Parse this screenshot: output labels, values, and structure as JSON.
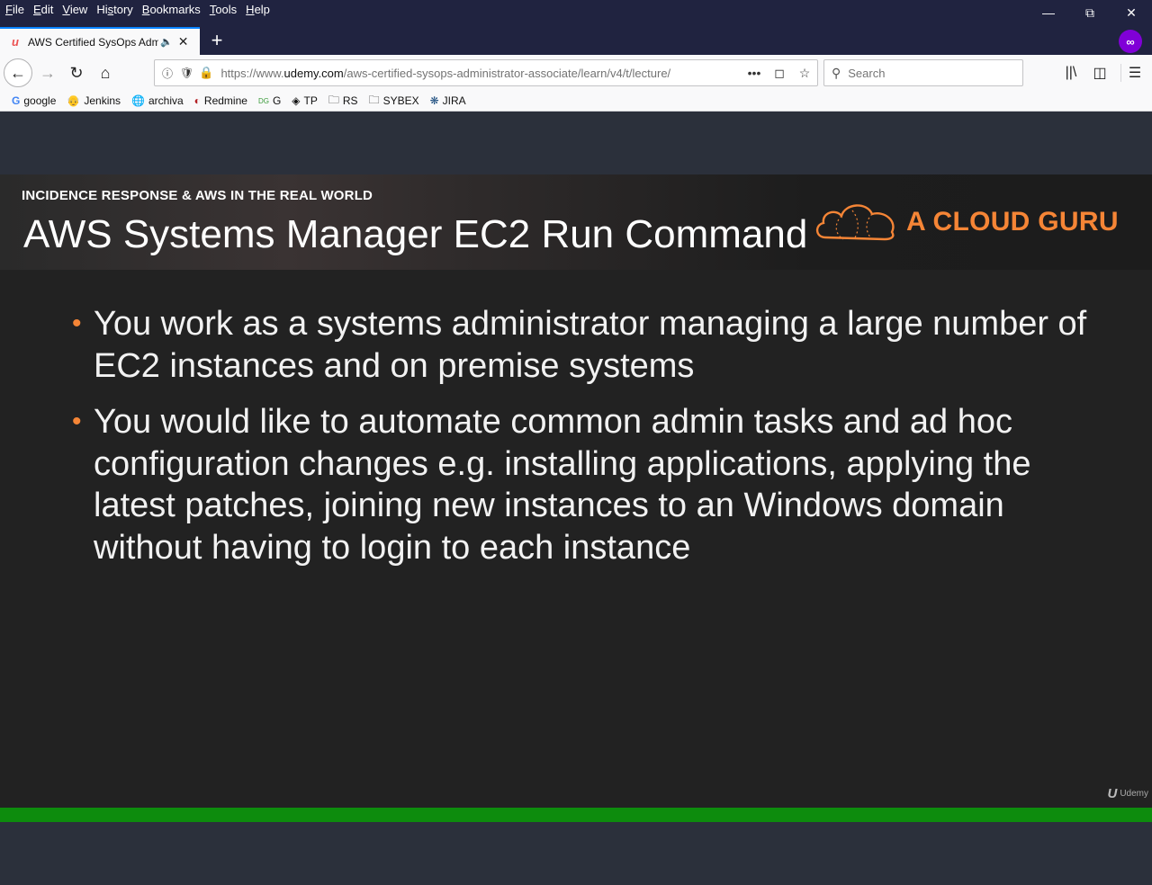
{
  "menu": {
    "items": [
      "File",
      "Edit",
      "View",
      "History",
      "Bookmarks",
      "Tools",
      "Help"
    ],
    "underline": [
      "F",
      "E",
      "V",
      "s",
      "B",
      "T",
      "H"
    ]
  },
  "tab": {
    "title": "AWS Certified SysOps Admin",
    "favicon": "udemy-icon"
  },
  "url": {
    "prefix": "https://www.",
    "domain": "udemy.com",
    "path": "/aws-certified-sysops-administrator-associate/learn/v4/t/lecture/"
  },
  "search": {
    "placeholder": "Search"
  },
  "bookmarks": [
    {
      "label": "google",
      "icon": "google-icon"
    },
    {
      "label": "Jenkins",
      "icon": "jenkins-icon"
    },
    {
      "label": "archiva",
      "icon": "globe-icon"
    },
    {
      "label": "Redmine",
      "icon": "redmine-icon"
    },
    {
      "label": "G",
      "icon": "g-icon"
    },
    {
      "label": "TP",
      "icon": "tp-icon"
    },
    {
      "label": "RS",
      "icon": "folder-icon"
    },
    {
      "label": "SYBEX",
      "icon": "folder-icon"
    },
    {
      "label": "JIRA",
      "icon": "jira-icon"
    }
  ],
  "slide": {
    "kicker": "INCIDENCE RESPONSE & AWS IN THE REAL WORLD",
    "title": "AWS Systems Manager EC2 Run Command",
    "brand": "A CLOUD GURU",
    "bullets": [
      "You work as a systems administrator managing a large number of EC2 instances and on premise systems",
      "You would like to automate common admin tasks and ad hoc configuration changes e.g. installing applications, applying the latest patches, joining new instances to an Windows domain without having to login to each instance"
    ],
    "watermark_logo": "U",
    "watermark": "Udemy"
  },
  "player": {
    "progress": 1.0
  },
  "colors": {
    "brand_orange": "#f58536",
    "progress_green": "#007c00",
    "titlebar": "#202340",
    "private": "#8000d7"
  }
}
